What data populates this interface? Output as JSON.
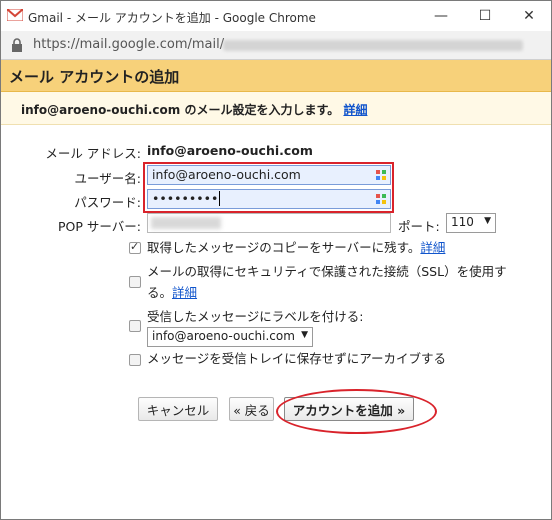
{
  "window": {
    "title": "Gmail - メール アカウントを追加 - Google Chrome",
    "controls": {
      "minimize": "—",
      "maximize": "☐",
      "close": "✕"
    }
  },
  "address_bar": {
    "url": "https://mail.google.com/mail/"
  },
  "dialog": {
    "header_title": "メール アカウントの追加",
    "subheading": "info@aroeno-ouchi.com のメール設定を入力します。",
    "subheading_link": "詳細",
    "email_label": "メール アドレス:",
    "email_value": "info@aroeno-ouchi.com",
    "username_label": "ユーザー名:",
    "username_value": "info@aroeno-ouchi.com",
    "password_label": "パスワード:",
    "password_value": "•••••••••",
    "pop_label": "POP サーバー:",
    "pop_value": "",
    "port_label": "ポート:",
    "port_value": "110",
    "options": [
      {
        "label": "取得したメッセージのコピーをサーバーに残す。",
        "link": "詳細",
        "checked": true
      },
      {
        "label": "メールの取得にセキュリティで保護された接続（SSL）を使用する。",
        "link": "詳細",
        "checked": false
      },
      {
        "label": "受信したメッセージにラベルを付ける:",
        "checked": false
      },
      {
        "label": "メッセージを受信トレイに保存せずにアーカイブする",
        "checked": false
      }
    ],
    "label_select_value": "info@aroeno-ouchi.com",
    "buttons": {
      "cancel": "キャンセル",
      "back": "« 戻る",
      "add": "アカウントを追加 »"
    }
  },
  "colors": {
    "header_bg": "#f7d17a",
    "link": "#1155cc",
    "highlight": "#d9232b"
  }
}
